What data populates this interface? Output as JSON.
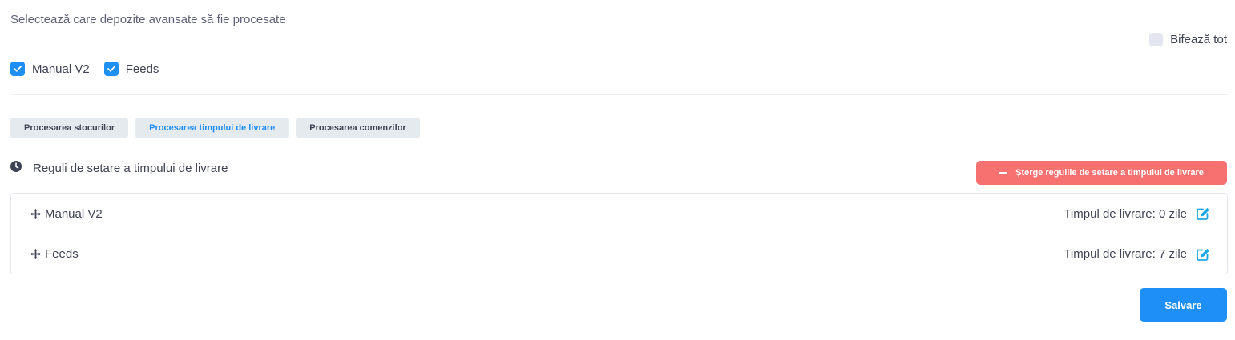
{
  "intro": {
    "text": "Selectează care depozite avansate să fie procesate"
  },
  "check_all": {
    "label": "Bifează tot",
    "checked": false
  },
  "warehouses": [
    {
      "label": "Manual V2",
      "checked": true
    },
    {
      "label": "Feeds",
      "checked": true
    }
  ],
  "tabs": [
    {
      "label": "Procesarea stocurilor",
      "active": false
    },
    {
      "label": "Procesarea timpului de livrare",
      "active": true
    },
    {
      "label": "Procesarea comenzilor",
      "active": false
    }
  ],
  "rules": {
    "title": "Reguli de setare a timpului de livrare",
    "delete_label": "Șterge regulile de setare a timpului de livrare",
    "items": [
      {
        "name": "Manual V2",
        "time": "Timpul de livrare: 0 zile"
      },
      {
        "name": "Feeds",
        "time": "Timpul de livrare: 7 zile"
      }
    ]
  },
  "save_label": "Salvare",
  "colors": {
    "primary": "#1e8ff6",
    "danger": "#f87171",
    "tab_bg": "#e4eaed",
    "edit_icon": "#1ea7e8"
  },
  "icons": {
    "clock": "clock-icon",
    "move": "move-icon",
    "edit": "edit-icon",
    "check": "check-icon",
    "minus": "minus-icon"
  }
}
